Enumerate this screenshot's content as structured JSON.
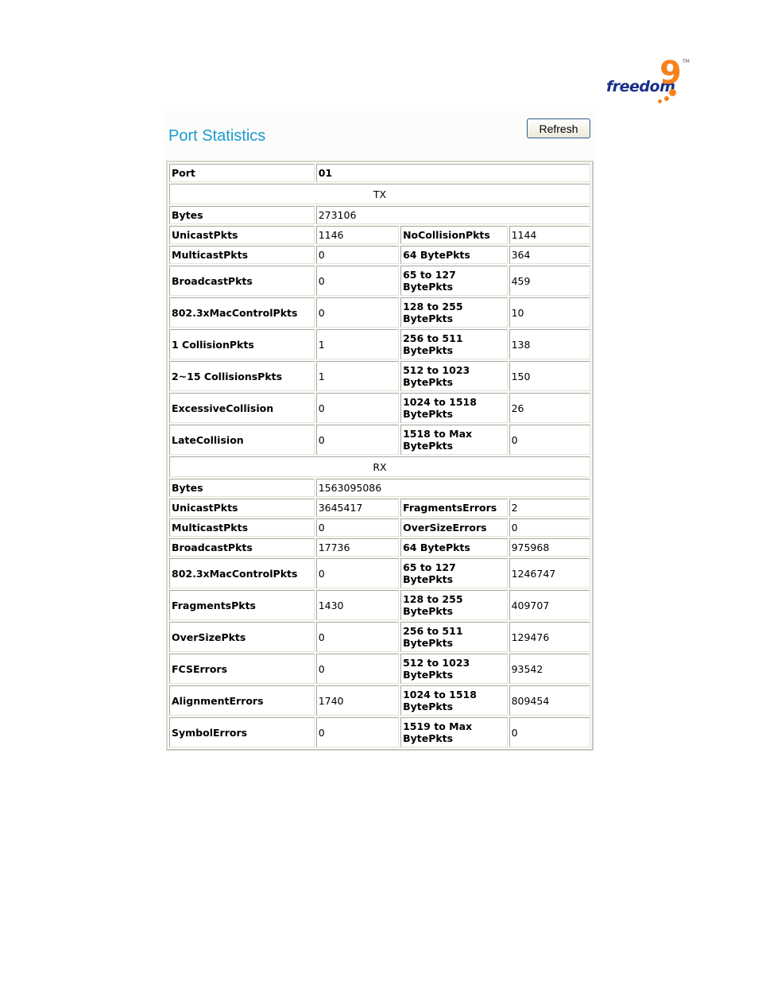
{
  "brand": {
    "logo_text": "freedom",
    "logo_mark": "9",
    "trademark": "TM",
    "primary_color": "#1a2f8a",
    "accent_color": "#f5821f"
  },
  "page": {
    "title": "Port Statistics",
    "refresh_label": "Refresh",
    "title_color": "#1a9bd0"
  },
  "port": {
    "label": "Port",
    "value": "01"
  },
  "tx": {
    "section_label": "TX",
    "bytes": {
      "label": "Bytes",
      "value": "273106"
    },
    "rows": [
      {
        "left_label": "UnicastPkts",
        "left_value": "1146",
        "right_label": "NoCollisionPkts",
        "right_value": "1144"
      },
      {
        "left_label": "MulticastPkts",
        "left_value": "0",
        "right_label": "64 BytePkts",
        "right_value": "364"
      },
      {
        "left_label": "BroadcastPkts",
        "left_value": "0",
        "right_label": "65 to 127 BytePkts",
        "right_value": "459"
      },
      {
        "left_label": "802.3xMacControlPkts",
        "left_value": "0",
        "right_label": "128 to 255 BytePkts",
        "right_value": "10"
      },
      {
        "left_label": "1 CollisionPkts",
        "left_value": "1",
        "right_label": "256 to 511 BytePkts",
        "right_value": "138"
      },
      {
        "left_label": "2~15 CollisionsPkts",
        "left_value": "1",
        "right_label": "512 to 1023 BytePkts",
        "right_value": "150"
      },
      {
        "left_label": "ExcessiveCollision",
        "left_value": "0",
        "right_label": "1024 to 1518 BytePkts",
        "right_value": "26"
      },
      {
        "left_label": "LateCollision",
        "left_value": "0",
        "right_label": "1518 to Max BytePkts",
        "right_value": "0"
      }
    ]
  },
  "rx": {
    "section_label": "RX",
    "bytes": {
      "label": "Bytes",
      "value": "1563095086"
    },
    "rows": [
      {
        "left_label": "UnicastPkts",
        "left_value": "3645417",
        "right_label": "FragmentsErrors",
        "right_value": "2"
      },
      {
        "left_label": "MulticastPkts",
        "left_value": "0",
        "right_label": "OverSizeErrors",
        "right_value": "0"
      },
      {
        "left_label": "BroadcastPkts",
        "left_value": "17736",
        "right_label": "64 BytePkts",
        "right_value": "975968"
      },
      {
        "left_label": "802.3xMacControlPkts",
        "left_value": "0",
        "right_label": "65 to 127 BytePkts",
        "right_value": "1246747"
      },
      {
        "left_label": "FragmentsPkts",
        "left_value": "1430",
        "right_label": "128 to 255 BytePkts",
        "right_value": "409707"
      },
      {
        "left_label": "OverSizePkts",
        "left_value": "0",
        "right_label": "256 to 511 BytePkts",
        "right_value": "129476"
      },
      {
        "left_label": "FCSErrors",
        "left_value": "0",
        "right_label": "512 to 1023 BytePkts",
        "right_value": "93542"
      },
      {
        "left_label": "AlignmentErrors",
        "left_value": "1740",
        "right_label": "1024 to 1518 BytePkts",
        "right_value": "809454"
      },
      {
        "left_label": "SymbolErrors",
        "left_value": "0",
        "right_label": "1519 to Max BytePkts",
        "right_value": "0"
      }
    ]
  }
}
